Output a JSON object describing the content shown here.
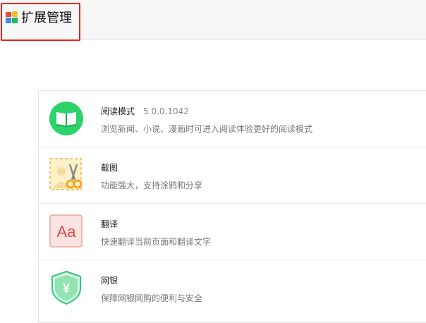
{
  "header": {
    "title": "扩展管理",
    "icon": "extensions-grid-icon"
  },
  "extensions": [
    {
      "name": "阅读模式",
      "version": "5.0.0.1042",
      "description": "浏览新闻、小说、漫画时可进入阅读体验更好的阅读模式",
      "icon": "book-icon",
      "color": "#2bd36a"
    },
    {
      "name": "截图",
      "version": "",
      "description": "功能强大，支持涂鸦和分享",
      "icon": "scissors-icon",
      "color": "#f5a623"
    },
    {
      "name": "翻译",
      "version": "",
      "description": "快速翻译当前页面和翻译文字",
      "icon": "translate-icon",
      "color": "#d9534f"
    },
    {
      "name": "网银",
      "version": "",
      "description": "保障网银网购的便利与安全",
      "icon": "shield-yuan-icon",
      "color": "#2ecc71"
    }
  ],
  "colors": {
    "highlight_border": "#e8231f",
    "background": "#ffffff",
    "topbar": "#f7f7f7"
  }
}
